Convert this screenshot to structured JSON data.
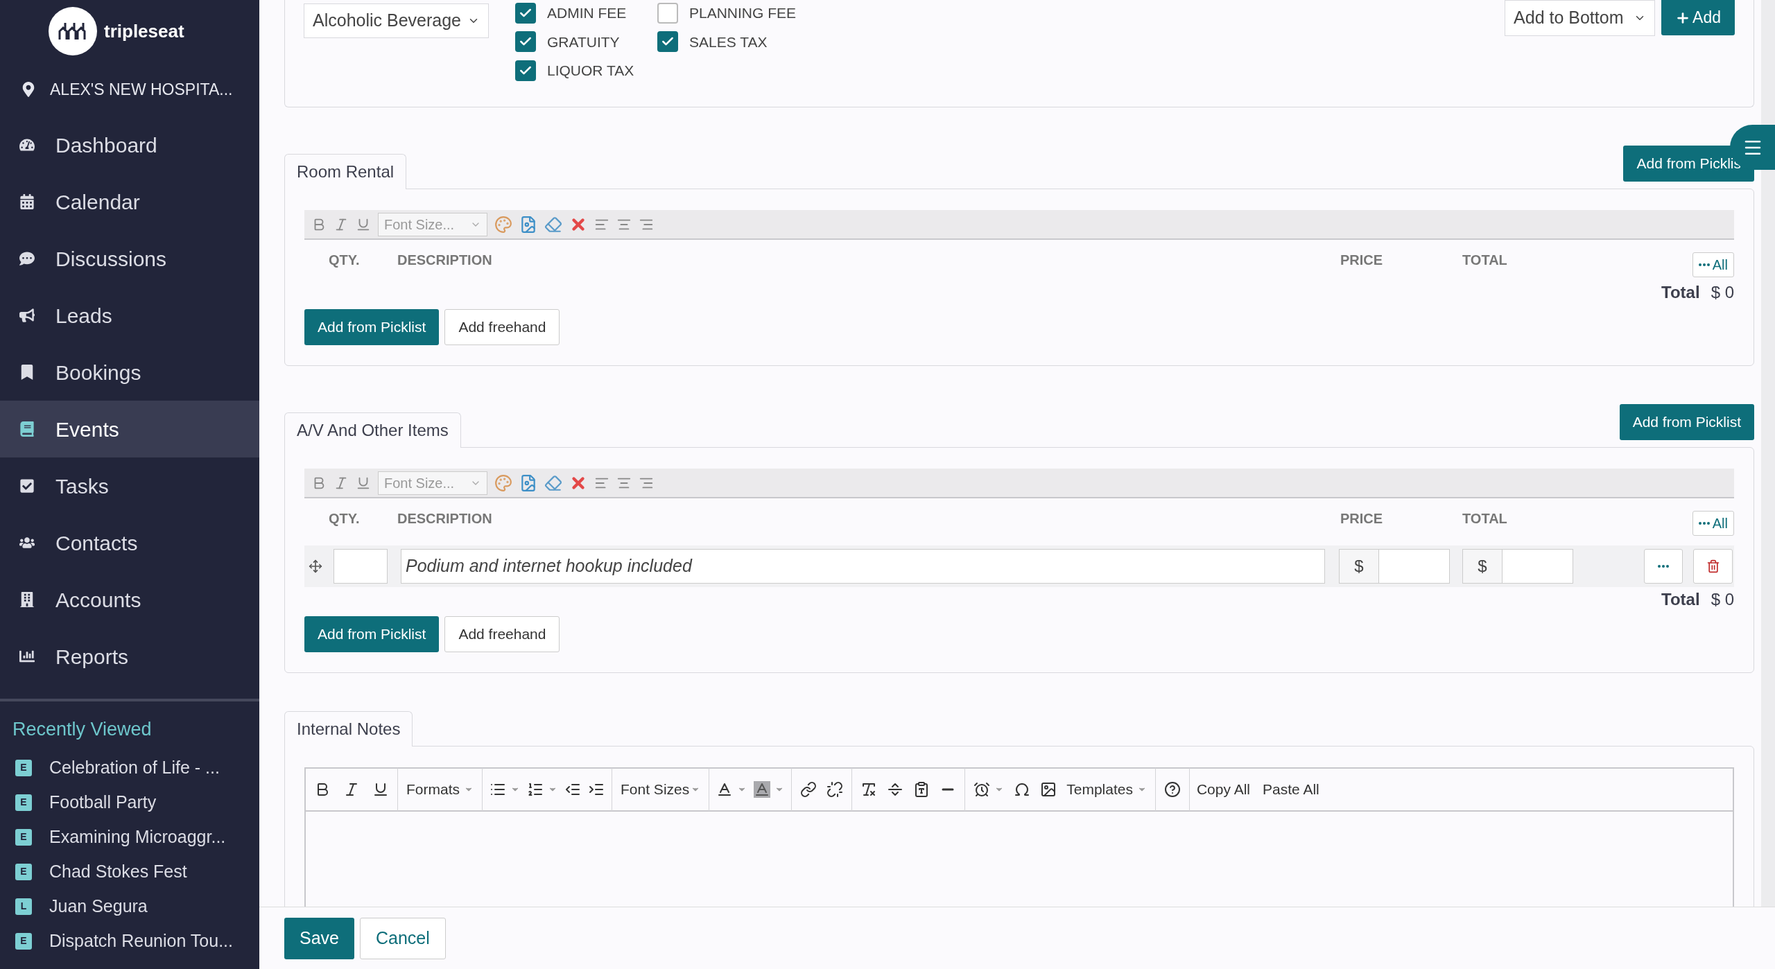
{
  "sidebar": {
    "brand": "tripleseat",
    "location": "ALEX'S NEW HOSPITA...",
    "nav": [
      {
        "label": "Dashboard",
        "selected": false
      },
      {
        "label": "Calendar",
        "selected": false
      },
      {
        "label": "Discussions",
        "selected": false
      },
      {
        "label": "Leads",
        "selected": false
      },
      {
        "label": "Bookings",
        "selected": false
      },
      {
        "label": "Events",
        "selected": true
      },
      {
        "label": "Tasks",
        "selected": false
      },
      {
        "label": "Contacts",
        "selected": false
      },
      {
        "label": "Accounts",
        "selected": false
      },
      {
        "label": "Reports",
        "selected": false
      }
    ],
    "recent_heading": "Recently Viewed",
    "recent": [
      {
        "badge": "E",
        "label": "Celebration of Life - ..."
      },
      {
        "badge": "E",
        "label": "Football Party"
      },
      {
        "badge": "E",
        "label": "Examining Microaggr..."
      },
      {
        "badge": "E",
        "label": "Chad Stokes Fest"
      },
      {
        "badge": "L",
        "label": "Juan Segura"
      },
      {
        "badge": "E",
        "label": "Dispatch Reunion Tou..."
      }
    ]
  },
  "top_panel": {
    "category_select": "Alcoholic Beverage",
    "fees": [
      {
        "label": "ADMIN FEE",
        "checked": true
      },
      {
        "label": "PLANNING FEE",
        "checked": false
      },
      {
        "label": "GRATUITY",
        "checked": true
      },
      {
        "label": "SALES TAX",
        "checked": true
      },
      {
        "label": "LIQUOR TAX",
        "checked": true
      }
    ],
    "position_select": "Add to Bottom",
    "add_button": "Add"
  },
  "sections": [
    {
      "title": "Room Rental",
      "picklist_button": "Add from Picklis",
      "font_size_placeholder": "Font Size...",
      "columns": [
        "QTY.",
        "DESCRIPTION",
        "PRICE",
        "TOTAL"
      ],
      "all_button": "All",
      "total_label": "Total",
      "total_value": "$ 0",
      "buttons": [
        "Add from Picklist",
        "Add freehand"
      ]
    },
    {
      "title": "A/V And Other Items",
      "picklist_button": "Add from Picklist",
      "font_size_placeholder": "Font Size...",
      "columns": [
        "QTY.",
        "DESCRIPTION",
        "PRICE",
        "TOTAL"
      ],
      "all_button": "All",
      "rows": [
        {
          "description": "Podium and internet hookup included",
          "price_prefix": "$",
          "total_prefix": "$"
        }
      ],
      "total_label": "Total",
      "total_value": "$ 0",
      "buttons": [
        "Add from Picklist",
        "Add freehand"
      ]
    }
  ],
  "internal_notes": {
    "title": "Internal Notes",
    "formats": "Formats",
    "font_sizes": "Font Sizes",
    "templates": "Templates",
    "copy_all": "Copy All",
    "paste_all": "Paste All"
  },
  "footer": {
    "save": "Save",
    "cancel": "Cancel"
  }
}
